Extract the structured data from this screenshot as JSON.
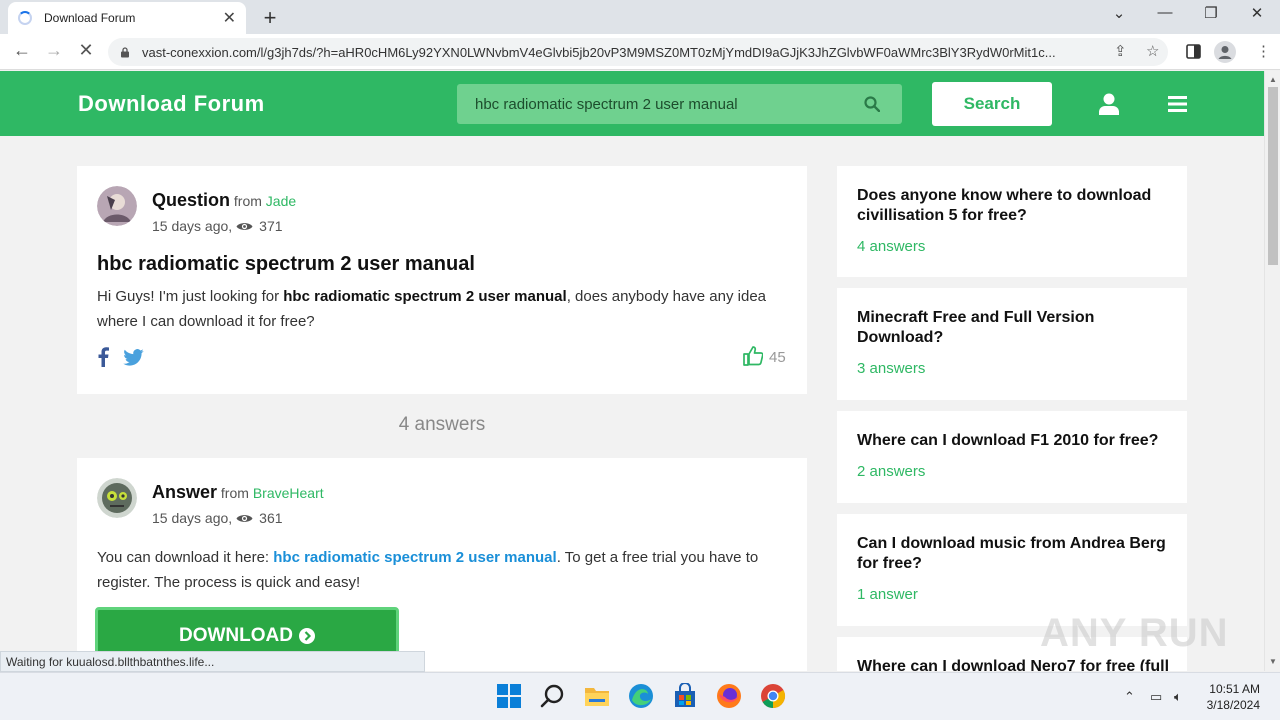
{
  "browser": {
    "tab_title": "Download Forum",
    "new_tab": "+",
    "url": "vast-conexxion.com/l/g3jh7ds/?h=aHR0cHM6Ly92YXN0LWNvbmV4eGlvbi5jb20vP3M9MSZ0MT0zMjYmdDI9aGJjK3JhZGlvbWF0aWMrc3BlY3RydW0rMit1c..."
  },
  "site": {
    "title": "Download Forum",
    "search_value": "hbc radiomatic spectrum 2 user manual",
    "search_button": "Search"
  },
  "question": {
    "role": "Question",
    "from": "from",
    "author": "Jade",
    "age": "15 days ago,",
    "views": "371",
    "title": "hbc radiomatic spectrum 2 user manual",
    "body_pre": "Hi Guys! I'm just looking for ",
    "body_bold": "hbc radiomatic spectrum 2 user manual",
    "body_post": ", does anybody have any idea where I can download it for free?",
    "likes": "45"
  },
  "answers_count": "4 answers",
  "answer": {
    "role": "Answer",
    "from": "from",
    "author": "BraveHeart",
    "age": "15 days ago,",
    "views": "361",
    "body_pre": "You can download it here: ",
    "body_link": "hbc radiomatic spectrum 2 user manual",
    "body_post": ". To get a free trial you have to register. The process is quick and easy!",
    "download_label": "DOWNLOAD"
  },
  "sidebar": [
    {
      "question": "Does anyone know where to download civillisation 5 for free?",
      "answers": "4 answers"
    },
    {
      "question": "Minecraft Free and Full Version Download?",
      "answers": "3 answers"
    },
    {
      "question": "Where can I download F1 2010 for free?",
      "answers": "2 answers"
    },
    {
      "question": "Can I download music from Andrea Berg for free?",
      "answers": "1 answer"
    },
    {
      "question": "Where can I download Nero7 for free (full",
      "answers": ""
    }
  ],
  "status_text": "Waiting for kuualosd.bllthbatnthes.life...",
  "watermark": "ANY RUN",
  "clock": {
    "time": "10:51 AM",
    "date": "3/18/2024"
  },
  "colors": {
    "brand_green": "#2fb864",
    "download_green": "#2aa844",
    "link_blue": "#1a8fd8"
  }
}
